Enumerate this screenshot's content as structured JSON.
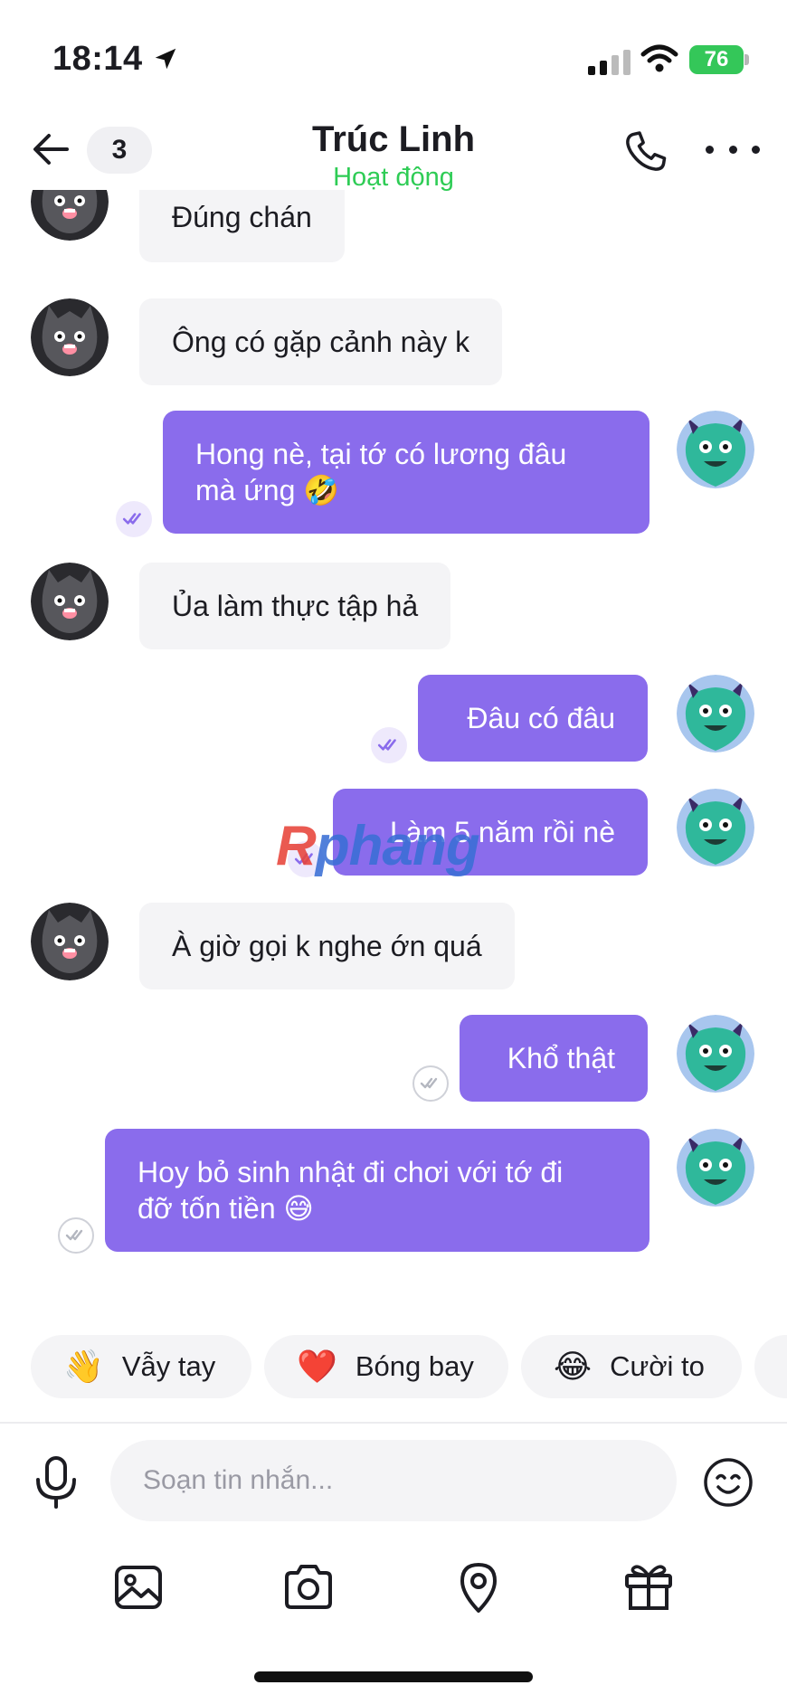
{
  "status_bar": {
    "time": "18:14",
    "battery": "76"
  },
  "header": {
    "back_count": "3",
    "title": "Trúc Linh",
    "subtitle": "Hoạt động"
  },
  "messages": [
    {
      "dir": "in",
      "text": "Đúng chán"
    },
    {
      "dir": "in",
      "text": "Ông có gặp cảnh này k"
    },
    {
      "dir": "out",
      "lines": [
        "Hong nè, tại tớ có lương đâu",
        "mà ứng 🤣"
      ],
      "status": "seen"
    },
    {
      "dir": "in",
      "text": "Ủa làm thực tập hả"
    },
    {
      "dir": "out",
      "text": "Đâu có đâu",
      "status": "seen"
    },
    {
      "dir": "out",
      "text": "Làm 5 năm rồi nè",
      "status": "seen"
    },
    {
      "dir": "in",
      "text": "À giờ gọi k nghe ớn quá"
    },
    {
      "dir": "out",
      "text": "Khổ thật",
      "status": "sent"
    },
    {
      "dir": "out",
      "lines": [
        "Hoy bỏ sinh nhật đi chơi với tớ đi",
        "đỡ tốn tiền 😅"
      ],
      "status": "sent"
    }
  ],
  "watermark": {
    "r": "R",
    "rest": "phang"
  },
  "quick_reactions": [
    {
      "emoji": "👋",
      "label": "Vẫy tay"
    },
    {
      "emoji": "❤️",
      "label": "Bóng bay"
    },
    {
      "emoji": "😂",
      "label": "Cười to"
    }
  ],
  "composer": {
    "placeholder": "Soạn tin nhắn..."
  },
  "icons": {
    "back": "back-arrow-icon",
    "call": "phone-icon",
    "more": "more-dots-icon",
    "mic": "microphone-icon",
    "emoji": "emoji-icon",
    "image": "image-icon",
    "camera": "camera-icon",
    "location": "location-pin-icon",
    "gift": "gift-icon"
  },
  "colors": {
    "outgoing_bubble": "#8a6cec",
    "incoming_bubble": "#f4f4f6",
    "online": "#2ecc55",
    "battery": "#34c759"
  }
}
